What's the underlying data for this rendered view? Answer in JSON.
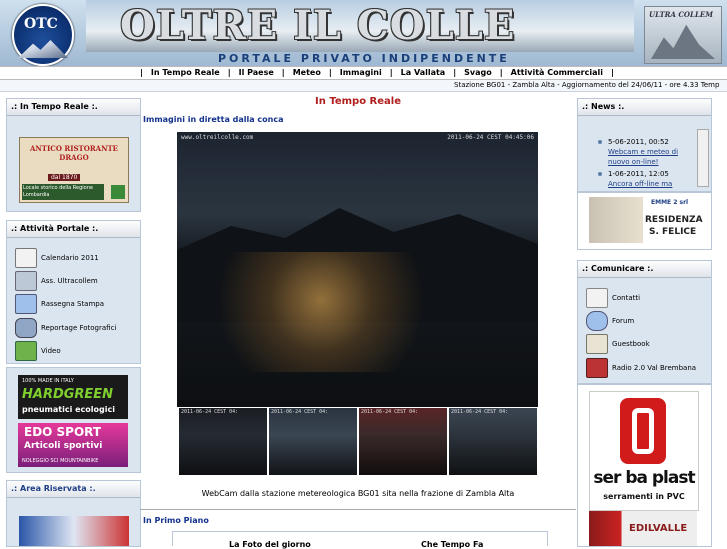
{
  "header": {
    "logo_text": "OLTRE IL COLLE",
    "badge_text": "OTC",
    "tagline": "PORTALE PRIVATO INDIPENDENTE",
    "right_logo": "ULTRA COLLEM"
  },
  "nav": {
    "items": [
      "In Tempo Reale",
      "Il Paese",
      "Meteo",
      "Immagini",
      "La Vallata",
      "Svago",
      "Attività Commerciali"
    ]
  },
  "ticker": "Stazione BG01 - Zambla Alta - Aggiornamento del 24/06/11 - ore 4.33    Temp",
  "left": {
    "realtime_title": ".: In Tempo Reale :.",
    "ad1": {
      "name": "ANTICO RISTORANTE DRAGO",
      "since": "dal 1870",
      "note": "Locale storico della Regione Lombardia"
    },
    "activities_title": ".: Attività Portale :.",
    "activities": [
      {
        "label": "Calendario 2011",
        "icon": "calendar-icon"
      },
      {
        "label": "Ass. Ultracollem",
        "icon": "association-icon"
      },
      {
        "label": "Rassegna Stampa",
        "icon": "press-icon"
      },
      {
        "label": "Reportage Fotografici",
        "icon": "camera-icon"
      },
      {
        "label": "Video",
        "icon": "video-icon"
      }
    ],
    "ad2": {
      "top": "100% MADE IN ITALY",
      "brand": "HARDGREEN",
      "sub": "pneumatici ecologici"
    },
    "ad3": {
      "brand": "EDO SPORT",
      "sub": "Articoli sportivi",
      "foot": "NOLEGGIO SCI MOUNTAINBIKE"
    },
    "area_title": ".: Area Riservata :."
  },
  "center": {
    "title": "In Tempo Reale",
    "subtitle": "Immagini in diretta dalla conca",
    "webcam_stamp_left": "www.oltreilcolle.com",
    "webcam_stamp_right": "2011-06-24 CEST 04:45:06",
    "thumbs": [
      "2011-06-24 CEST 04:",
      "2011-06-24 CEST 04:",
      "2011-06-24 CEST 04:",
      "2011-06-24 CEST 04:"
    ],
    "caption": "WebCam dalla stazione metereologica BG01 sita nella frazione di Zambla Alta",
    "primo_title": "In Primo Piano",
    "primo_a": "La Foto del giorno",
    "primo_b": "Che Tempo Fa"
  },
  "right": {
    "news_title": ".: News :.",
    "news": [
      {
        "date": "5-06-2011, 00:52",
        "text": "Webcam e meteo di nuovo on-line!"
      },
      {
        "date": "1-06-2011, 12:05",
        "text": "Ancora off-line ma"
      }
    ],
    "residenza": {
      "brand": "EMME 2 srl",
      "name": "RESIDENZA",
      "name2": "S. FELICE"
    },
    "comunicare_title": ".: Comunicare :.",
    "comunicare": [
      {
        "label": "Contatti",
        "icon": "mail-icon"
      },
      {
        "label": "Forum",
        "icon": "forum-icon"
      },
      {
        "label": "Guestbook",
        "icon": "guestbook-icon"
      },
      {
        "label": "Radio 2.0 Val Brembana",
        "icon": "radio-icon"
      }
    ],
    "serbaplast": {
      "name": "ser ba plast",
      "sub": "serramenti in PVC"
    },
    "edilvalle": "EDILVALLE"
  },
  "colors": {
    "accent": "#13328c",
    "title_red": "#b01e1e",
    "panel": "#dbe5f0"
  }
}
